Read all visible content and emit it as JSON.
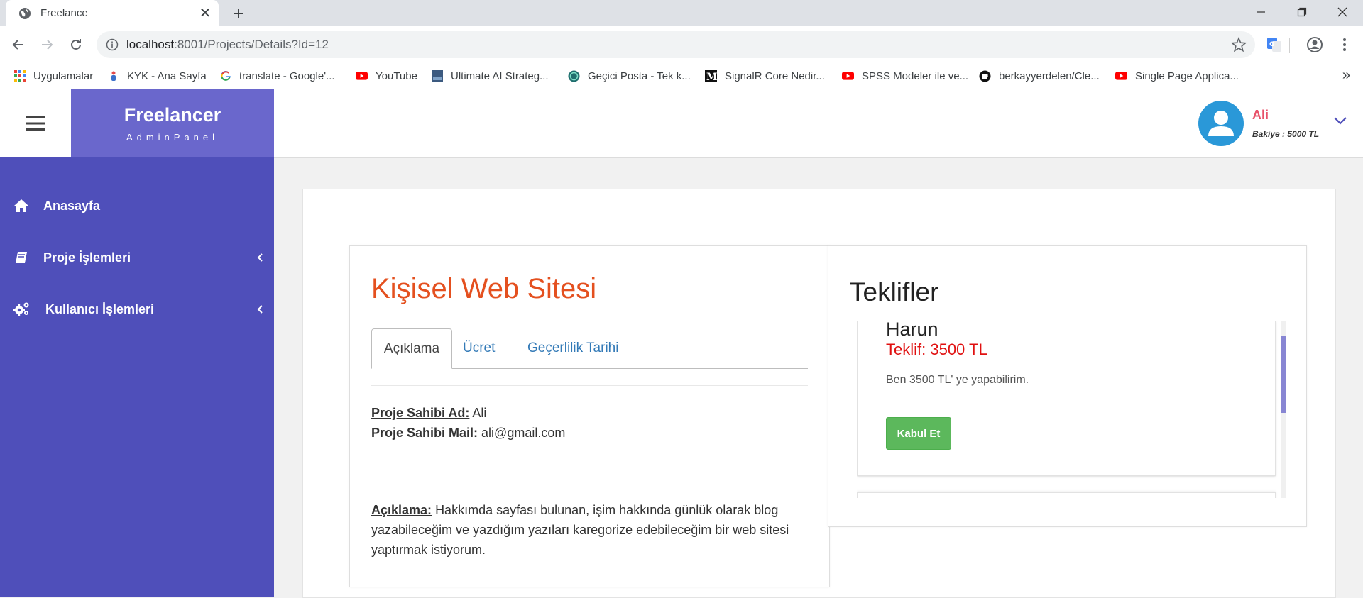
{
  "browser": {
    "tab_title": "Freelance",
    "url_host": "localhost",
    "url_rest": ":8001/Projects/Details?Id=12",
    "bookmarks": [
      {
        "label": "Uygulamalar",
        "icon": "apps-grid-icon"
      },
      {
        "label": "KYK - Ana Sayfa",
        "icon": "kyk-icon"
      },
      {
        "label": "translate - Google'...",
        "icon": "google-icon"
      },
      {
        "label": "YouTube",
        "icon": "youtube-icon"
      },
      {
        "label": "Ultimate AI Strateg...",
        "icon": "page-icon"
      },
      {
        "label": "Geçici Posta - Tek k...",
        "icon": "globe-icon"
      },
      {
        "label": "SignalR Core Nedir...",
        "icon": "medium-icon"
      },
      {
        "label": "SPSS Modeler ile ve...",
        "icon": "youtube-icon"
      },
      {
        "label": "berkayyerdelen/Cle...",
        "icon": "github-icon"
      },
      {
        "label": "Single Page Applica...",
        "icon": "youtube-icon"
      }
    ],
    "more": "»"
  },
  "app": {
    "brand_title": "Freelancer",
    "brand_sub": "AdminPanel",
    "user_name": "Ali",
    "user_balance": "Bakiye : 5000 TL",
    "sidebar": [
      {
        "label": "Anasayfa",
        "icon": "home-icon",
        "has_arrow": false
      },
      {
        "label": "Proje İşlemleri",
        "icon": "book-icon",
        "has_arrow": true
      },
      {
        "label": "Kullanıcı İşlemleri",
        "icon": "gears-icon",
        "has_arrow": true
      }
    ]
  },
  "project": {
    "title": "Kişisel Web Sitesi",
    "tabs": [
      "Açıklama",
      "Ücret",
      "Geçerlilik Tarihi"
    ],
    "owner_name_label": "Proje Sahibi Ad:",
    "owner_name": "Ali",
    "owner_mail_label": "Proje Sahibi Mail:",
    "owner_mail": "ali@gmail.com",
    "desc_label": "Açıklama:",
    "desc_text": "Hakkımda sayfası bulunan, işim hakkında günlük olarak blog yazabileceğim ve yazdığım yazıları karegorize edebileceğim bir web sitesi yaptırmak istiyorum."
  },
  "offers": {
    "title": "Teklifler",
    "items": [
      {
        "name": "Harun",
        "amount": "Teklif: 3500 TL",
        "text": "Ben 3500 TL' ye yapabilirim.",
        "button": "Kabul Et"
      }
    ]
  },
  "colors": {
    "sidebar": "#4f4fba",
    "brand": "#6a67cc",
    "project_title": "#e4501f",
    "offer_amount": "#e01010",
    "accept": "#5cb85c",
    "user_name": "#e8536b"
  }
}
